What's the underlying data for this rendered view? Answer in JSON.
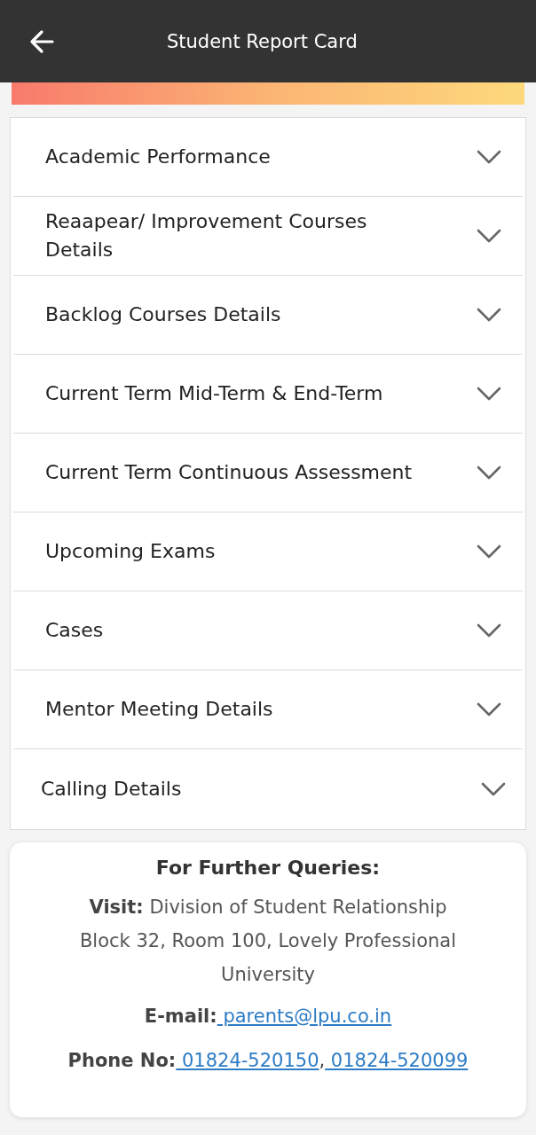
{
  "header": {
    "title": "Student Report Card"
  },
  "sections": [
    {
      "title": "Academic Performance",
      "expanded": false
    },
    {
      "title": "Reaapear/ Improvement Courses Details",
      "expanded": false
    },
    {
      "title": "Backlog Courses Details",
      "expanded": false
    },
    {
      "title": "Current Term Mid-Term & End-Term",
      "expanded": false
    },
    {
      "title": "Current Term Continuous Assessment",
      "expanded": false
    },
    {
      "title": "Upcoming Exams",
      "expanded": false
    },
    {
      "title": "Cases",
      "expanded": false
    },
    {
      "title": "Mentor Meeting Details",
      "expanded": false
    },
    {
      "title": "Calling Details",
      "expanded": false
    }
  ],
  "queries": {
    "heading": "For Further Queries:",
    "visit": "**Visit:** Division of Student Relationship Block 32, Room 100, Lovely Professional University",
    "email": {
      "label": "E-mail:",
      "link": "parents@lpu.co.in"
    },
    "phone": {
      "label": "Phone No:",
      "links": [
        "01824-520150",
        "01824-520099"
      ],
      "separator": ","
    }
  }
}
